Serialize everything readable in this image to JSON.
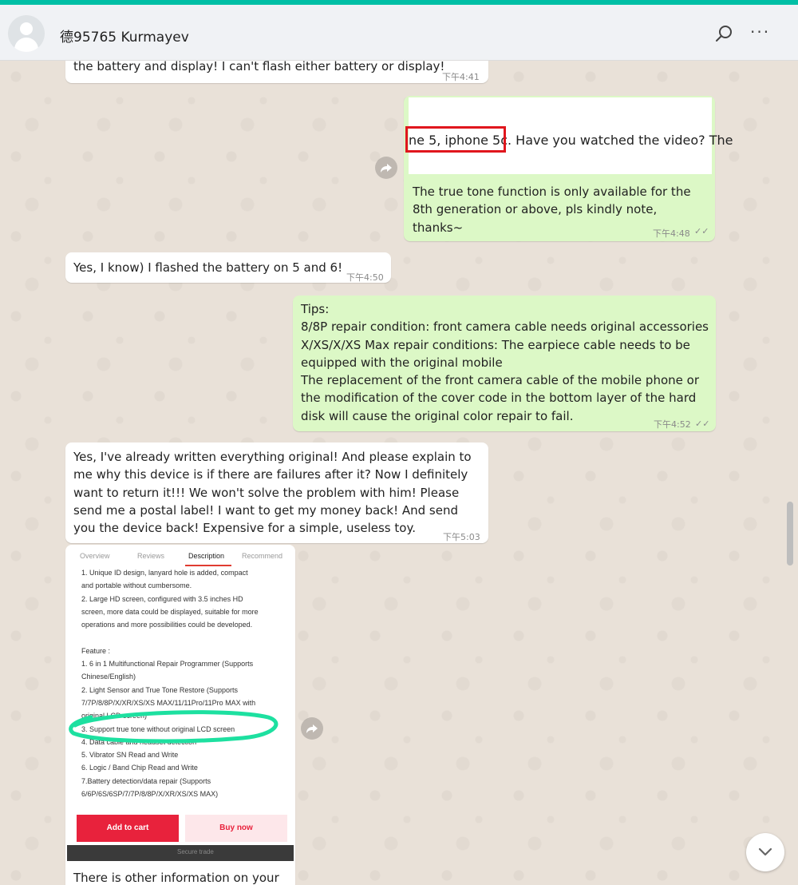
{
  "header": {
    "contact_name": "德95765 Kurmayev"
  },
  "messages": [
    {
      "id": "m1",
      "direction": "in",
      "text": "the battery and display! I can't flash either battery or display!",
      "time": "下午4:41"
    },
    {
      "id": "m2",
      "direction": "out",
      "image_caption_text": "ne 5, iphone 5c. Have you watched the video? The",
      "highlight_text": "ne 5, iphone 5c.",
      "text": "The true tone function is only available for the 8th generation or above, pls kindly note, thanks~",
      "time": "下午4:48"
    },
    {
      "id": "m3",
      "direction": "in",
      "text": "Yes, I know) I flashed the battery on 5 and 6!",
      "time": "下午4:50"
    },
    {
      "id": "m4",
      "direction": "out",
      "text": "Tips:\n8/8P repair condition: front camera cable needs original accessories\nX/XS/X/XS Max repair conditions: The earpiece cable needs to be equipped with the original mobile\nThe replacement of the front camera cable of the mobile phone or the modification of the cover code in the bottom layer of the hard disk will cause the original color repair to fail.",
      "time": "下午4:52"
    },
    {
      "id": "m5",
      "direction": "in",
      "text": "Yes, I've already written everything original! And please explain to me why this device is if there are failures after it? Now I definitely want to return it!!! We won't solve the problem with him! Please send me a postal label! I want to get my money back! And send you the device back! Expensive for a simple, useless toy.",
      "time": "下午5:03"
    },
    {
      "id": "m6",
      "direction": "in",
      "text": "There is other information on your"
    }
  ],
  "product_shot": {
    "tabs": [
      "Overview",
      "Reviews",
      "Description",
      "Recommend"
    ],
    "active_tab": "Description",
    "description": "1. Unique ID design, lanyard hole is added, compact\nand portable without cumbersome.\n2. Large HD screen, configured with 3.5 inches HD\nscreen, more data could be displayed, suitable for more\noperations and more possibilities could be developed.\n\nFeature :\n1. 6 in 1 Multifunctional Repair Programmer (Supports\nChinese/English)\n2. Light Sensor and True Tone Restore (Supports\n7/7P/8/8P/X/XR/XS/XS MAX/11/11Pro/11Pro MAX with\noriginal LCD screen)\n3. Support true tone without original LCD screen\n4. Data cable and headset detection\n5. Vibrator SN Read and Write\n6. Logic / Band Chip Read and Write\n7.Battery detection/data repair (Supports\n6/6P/6S/6SP/7/7P/8/8P/X/XR/XS/XS MAX)",
    "add_to_cart": "Add to cart",
    "buy_now": "Buy now",
    "bottom_text": "Secure trade"
  },
  "colors": {
    "accent": "#00bfa5",
    "incoming_bubble": "#ffffff",
    "outgoing_bubble": "#dcf8c6",
    "highlight_red": "#e0161d",
    "highlight_green": "#1de0a0",
    "cart_red": "#e8223c"
  },
  "icons": {
    "search": "search-icon",
    "more": "more-icon",
    "forward": "forward-icon",
    "scroll_down": "chevron-down-icon",
    "read_receipt": "double-check-icon"
  },
  "read_receipt_glyph": "✓✓",
  "more_glyph": "···"
}
